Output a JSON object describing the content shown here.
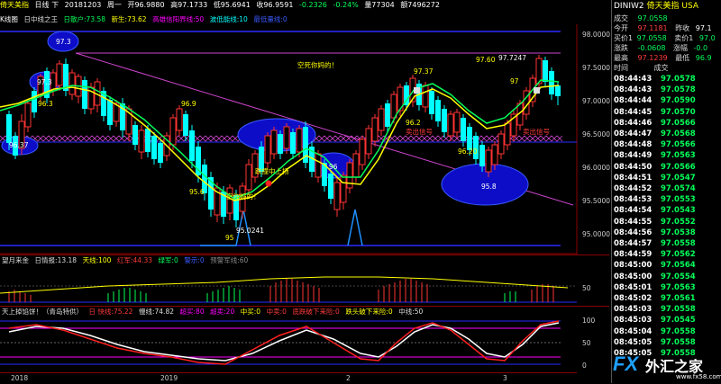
{
  "header": {
    "name": "倚天美指",
    "period": "日线 下",
    "date": "20181203",
    "weekday": "周一",
    "open": "开96.9880",
    "high": "高97.1733",
    "low": "低95.6941",
    "close": "收96.9591",
    "change": "-0.2326",
    "pct": "-0.24%",
    "volume": "量77304",
    "amount": "额7496272"
  },
  "main_indicator": {
    "name": "K线图",
    "items": [
      {
        "label": "日中线之王",
        "color": "#dddddd"
      },
      {
        "label": "日散户:73.58",
        "color": "#00ff5a"
      },
      {
        "label": "新生:73.62",
        "color": "#ffff00"
      },
      {
        "label": "高雄信阳界线:50",
        "color": "#ff00ff"
      },
      {
        "label": "波低能线:10",
        "color": "#00ffff"
      },
      {
        "label": "最低量线:0",
        "color": "#3a5bff"
      }
    ]
  },
  "price_axis": [
    "98.0000",
    "97.5000",
    "97.0000",
    "96.5000",
    "96.0000",
    "95.5000",
    "95.0000"
  ],
  "annotations": {
    "a973": "97.3",
    "a973b": "97.3",
    "a963": "96.3",
    "a9637": "96.37",
    "a969": "96.9",
    "a956": "95.6",
    "a95": "95",
    "a950241": "95.0241",
    "a962": "96.2",
    "a96": "96",
    "a9620": "96.20",
    "a958": "95.8",
    "a9737": "97.37",
    "a9760": "97.60",
    "a977247": "97.7247",
    "a97": "97",
    "t_top": "空死你妈的！",
    "t_mid": "跌撞中上扬",
    "t_low": "空你妈的！",
    "t_r1": "卖出信号",
    "t_r2": "卖出信号"
  },
  "sub1": {
    "items": [
      {
        "label": "望月来金",
        "color": "#dddddd"
      },
      {
        "label": "日情报:13.18",
        "color": "#dddddd"
      },
      {
        "label": "天线:100",
        "color": "#ffff00"
      },
      {
        "label": "红军:44.33",
        "color": "#ff3b3b"
      },
      {
        "label": "绿军:0",
        "color": "#00ff5a"
      },
      {
        "label": "警示:0",
        "color": "#3a5bff"
      },
      {
        "label": "预警军线:60",
        "color": "#888888"
      }
    ]
  },
  "sub2": {
    "items": [
      {
        "label": "天上掉馅饼！（青岛特供）",
        "color": "#dddddd"
      },
      {
        "label": "日 快线:75.22",
        "color": "#ff3b3b"
      },
      {
        "label": "慢线:74.82",
        "color": "#dddddd"
      },
      {
        "label": "超买:80",
        "color": "#ff00ff"
      },
      {
        "label": "超卖:20",
        "color": "#ff00ff"
      },
      {
        "label": "中买:0",
        "color": "#ffff00"
      },
      {
        "label": "中卖:0",
        "color": "#ff3b3b"
      },
      {
        "label": "底跌破下来险:0",
        "color": "#ff3b3b"
      },
      {
        "label": "跌头破下来险:0",
        "color": "#ffff00"
      },
      {
        "label": "中线:50",
        "color": "#dddddd"
      }
    ],
    "axis": [
      "100",
      "50",
      "0"
    ]
  },
  "sub1_axis": [
    "50"
  ],
  "time_axis": [
    "2018",
    "2019",
    "2",
    "3"
  ],
  "right_panel": {
    "title": "DINIW2",
    "name": "倚天美指",
    "currency": "USA",
    "rows": [
      {
        "l1": "成交",
        "v1": "97.0558",
        "c1": "dn",
        "l2": "",
        "v2": "",
        "c2": "wt"
      },
      {
        "l1": "今开",
        "v1": "97.1181",
        "c1": "up",
        "l2": "昨收",
        "v2": "97.1",
        "c2": "wt"
      },
      {
        "l1": "买价1",
        "v1": "97.0558",
        "c1": "dn",
        "l2": "卖价1",
        "v2": "97.0",
        "c2": "dn"
      },
      {
        "l1": "涨跌",
        "v1": "-0.0608",
        "c1": "dn",
        "l2": "涨幅",
        "v2": "-0.0",
        "c2": "dn"
      },
      {
        "l1": "最高",
        "v1": "97.1239",
        "c1": "up",
        "l2": "最低",
        "v2": "96.9",
        "c2": "dn"
      }
    ],
    "tick_header": {
      "time": "时间",
      "price": "成交"
    },
    "ticks": [
      {
        "time": "08:44:43",
        "price": "97.0578"
      },
      {
        "time": "08:44:43",
        "price": "97.0578"
      },
      {
        "time": "08:44:44",
        "price": "97.0590"
      },
      {
        "time": "08:44:45",
        "price": "97.0570"
      },
      {
        "time": "08:44:46",
        "price": "97.0566"
      },
      {
        "time": "08:44:47",
        "price": "97.0568"
      },
      {
        "time": "08:44:48",
        "price": "97.0566"
      },
      {
        "time": "08:44:49",
        "price": "97.0563"
      },
      {
        "time": "08:44:50",
        "price": "97.0566"
      },
      {
        "time": "08:44:51",
        "price": "97.0547"
      },
      {
        "time": "08:44:52",
        "price": "97.0574"
      },
      {
        "time": "08:44:53",
        "price": "97.0553"
      },
      {
        "time": "08:44:54",
        "price": "97.0543"
      },
      {
        "time": "08:44:55",
        "price": "97.0552"
      },
      {
        "time": "08:44:56",
        "price": "97.0538"
      },
      {
        "time": "08:44:57",
        "price": "97.0558"
      },
      {
        "time": "08:44:59",
        "price": "97.0562"
      },
      {
        "time": "08:45:00",
        "price": "97.0564"
      },
      {
        "time": "08:45:00",
        "price": "97.0554"
      },
      {
        "time": "08:45:01",
        "price": "97.0563"
      },
      {
        "time": "08:45:02",
        "price": "97.0561"
      },
      {
        "time": "08:45:03",
        "price": "97.0558"
      },
      {
        "time": "08:45:03",
        "price": "97.0545"
      },
      {
        "time": "08:45:04",
        "price": "97.0558"
      },
      {
        "time": "08:45:05",
        "price": "97.0558"
      },
      {
        "time": "08:45:05",
        "price": "97.0558"
      }
    ]
  },
  "watermark": {
    "brand": "FX",
    "text": "外汇之家",
    "url": "www.fx58.com"
  }
}
